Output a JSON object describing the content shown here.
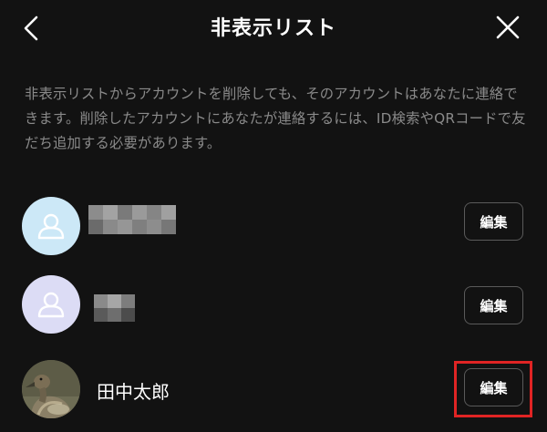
{
  "header": {
    "title": "非表示リスト",
    "back_icon": "chevron-left-icon",
    "close_icon": "close-icon"
  },
  "description": "非表示リストからアカウントを削除しても、そのアカウントはあなたに連絡できます。削除したアカウントにあなたが連絡するには、ID検索やQRコードで友だち追加する必要があります。",
  "contacts": [
    {
      "name": "",
      "avatar": "person-icon",
      "avatar_color": "#cce8f7",
      "name_blurred": true,
      "edit_label": "編集"
    },
    {
      "name": "",
      "avatar": "person-icon",
      "avatar_color": "#dcdcf5",
      "name_blurred": true,
      "edit_label": "編集"
    },
    {
      "name": "田中太郎",
      "avatar": "duck-photo",
      "name_blurred": false,
      "edit_label": "編集"
    }
  ],
  "colors": {
    "background": "#121212",
    "highlight": "#e02424",
    "description_text": "#8a8a8a"
  }
}
